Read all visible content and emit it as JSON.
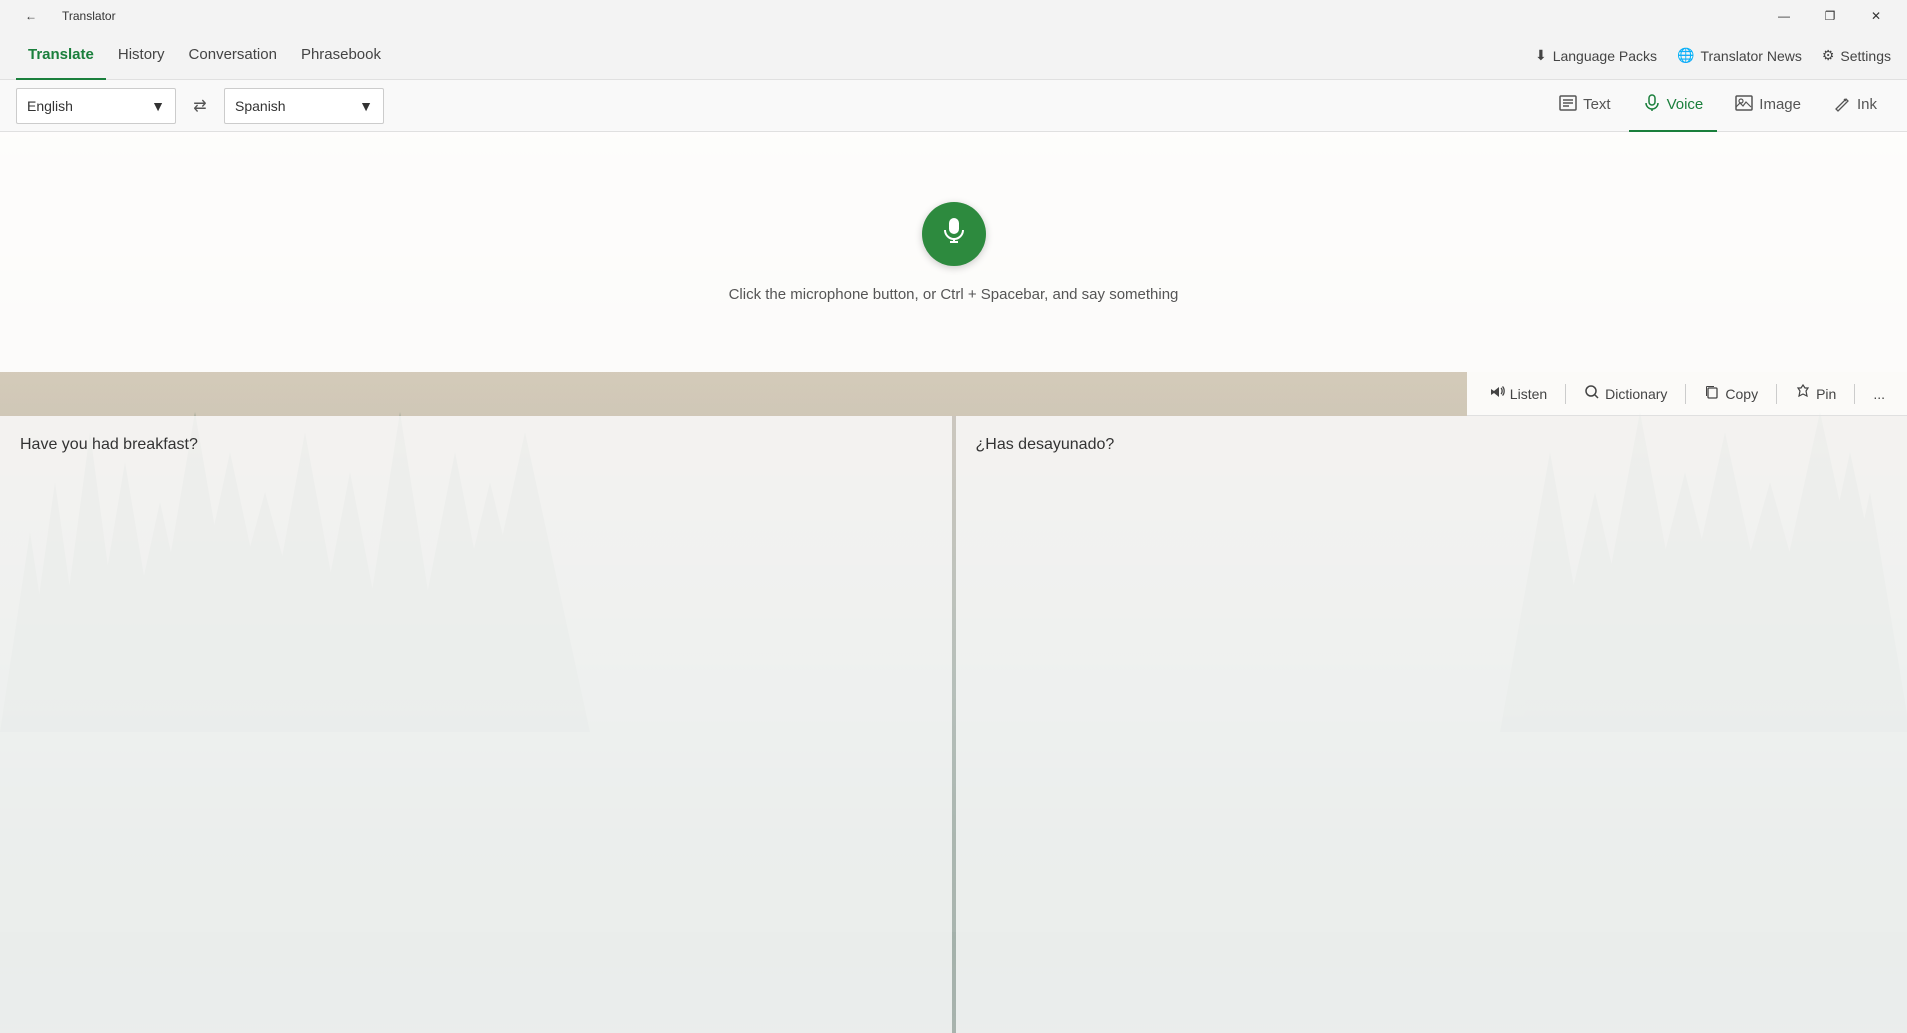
{
  "titleBar": {
    "title": "Translator",
    "backBtn": "←",
    "minBtn": "—",
    "restoreBtn": "❐",
    "closeBtn": "✕"
  },
  "nav": {
    "tabs": [
      {
        "id": "translate",
        "label": "Translate",
        "active": true
      },
      {
        "id": "history",
        "label": "History",
        "active": false
      },
      {
        "id": "conversation",
        "label": "Conversation",
        "active": false
      },
      {
        "id": "phrasebook",
        "label": "Phrasebook",
        "active": false
      }
    ],
    "rightItems": [
      {
        "id": "language-packs",
        "icon": "⬇",
        "label": "Language Packs"
      },
      {
        "id": "translator-news",
        "icon": "🌐",
        "label": "Translator News"
      },
      {
        "id": "settings",
        "icon": "⚙",
        "label": "Settings"
      }
    ]
  },
  "langBar": {
    "sourceLang": "English",
    "targetLang": "Spanish",
    "swapIcon": "⇄",
    "modes": [
      {
        "id": "text",
        "icon": "📝",
        "label": "Text",
        "active": false
      },
      {
        "id": "voice",
        "icon": "🎤",
        "label": "Voice",
        "active": true
      },
      {
        "id": "image",
        "icon": "🖼",
        "label": "Image",
        "active": false
      },
      {
        "id": "ink",
        "icon": "✏",
        "label": "Ink",
        "active": false
      }
    ]
  },
  "recording": {
    "micHint": "Click the microphone button, or Ctrl + Spacebar, and say something"
  },
  "toolbar": {
    "listenLabel": "Listen",
    "dictionaryLabel": "Dictionary",
    "copyLabel": "Copy",
    "pinLabel": "Pin",
    "moreLabel": "..."
  },
  "panels": {
    "sourceText": "Have you had breakfast?",
    "translatedText": "¿Has desayunado?"
  }
}
